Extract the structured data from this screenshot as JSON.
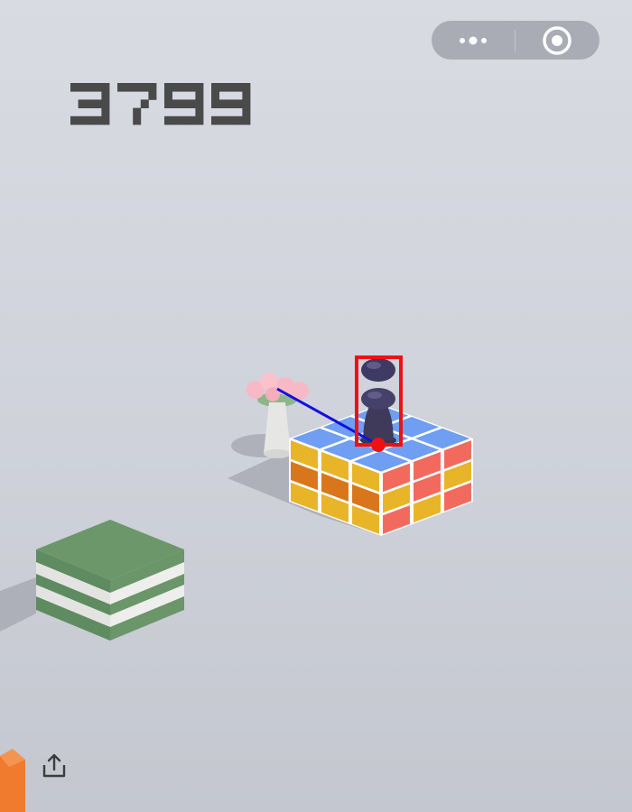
{
  "game": {
    "score": "3799",
    "score_color": "#4a4a4a",
    "background_color": "#d3d5dd"
  },
  "capsule": {
    "menu_icon": "more-dots-icon",
    "close_icon": "target-circle-icon"
  },
  "toolbar": {
    "share_icon": "share-icon"
  },
  "platforms": [
    {
      "name": "rubik-cube-platform",
      "top_color": "#6f9ef2",
      "side_colors": [
        "#e8b428",
        "#f26a5e",
        "#d9761b"
      ]
    },
    {
      "name": "green-striped-block",
      "top_color": "#6a966a",
      "stripe_color": "#e6e7e5"
    }
  ],
  "overlay": {
    "box_color": "#ee1111",
    "line_color": "#1010e0"
  }
}
